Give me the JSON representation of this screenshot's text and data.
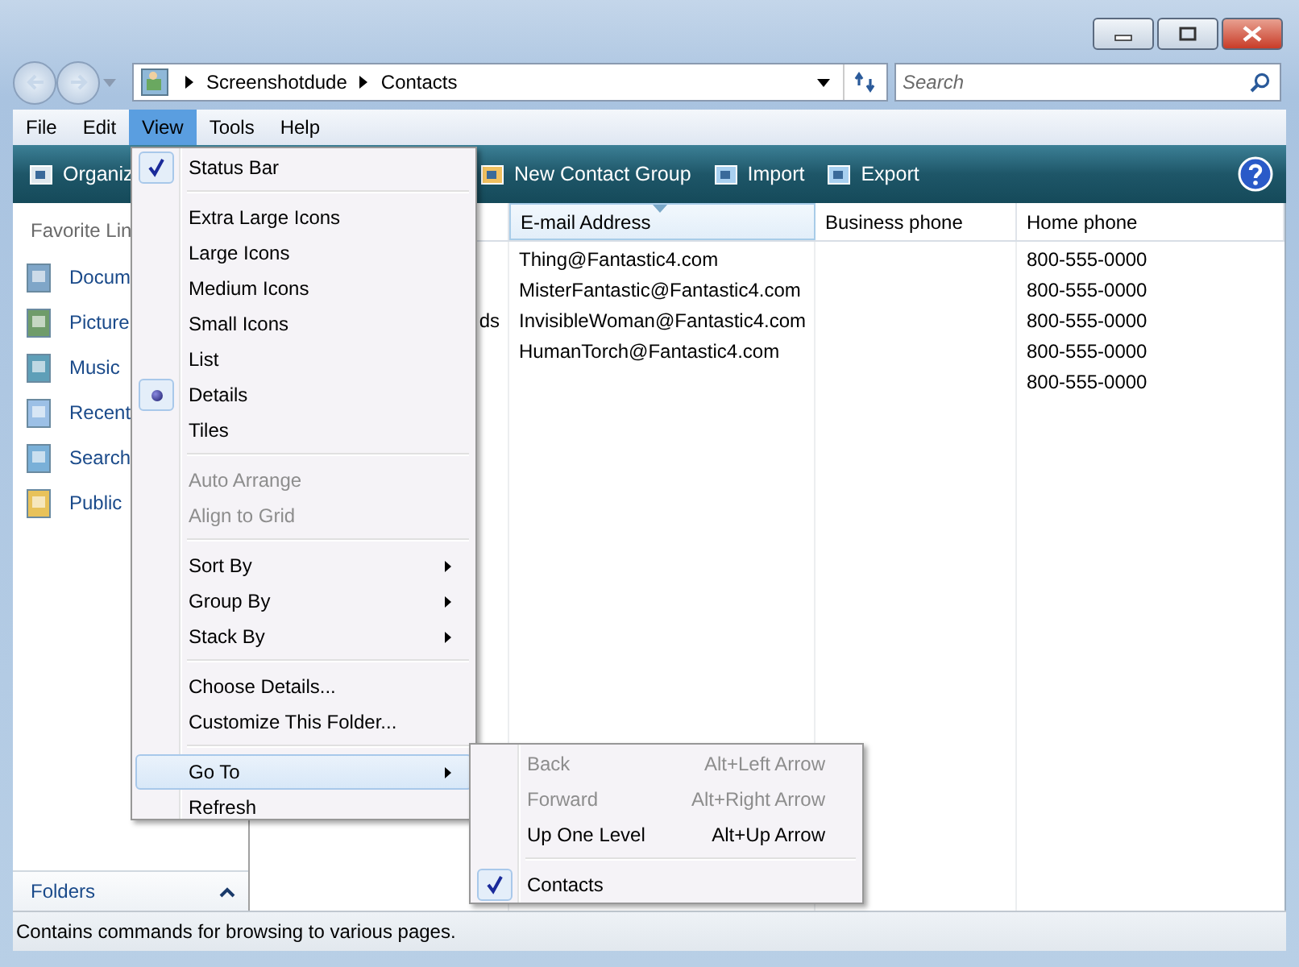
{
  "address": {
    "crumbs": [
      "Screenshotdude",
      "Contacts"
    ]
  },
  "search": {
    "placeholder": "Search"
  },
  "menubar": {
    "items": [
      {
        "label": "File",
        "selected": false
      },
      {
        "label": "Edit",
        "selected": false
      },
      {
        "label": "View",
        "selected": true
      },
      {
        "label": "Tools",
        "selected": false
      },
      {
        "label": "Help",
        "selected": false
      }
    ]
  },
  "toolbar": {
    "items": [
      {
        "label": "Organiz",
        "kind": "organize"
      },
      {
        "label": "New Contact Group",
        "kind": "group"
      },
      {
        "label": "Import",
        "kind": "import"
      },
      {
        "label": "Export",
        "kind": "export"
      }
    ]
  },
  "nav": {
    "heading": "Favorite Lin",
    "items": [
      {
        "label": "Docum",
        "kind": "documents"
      },
      {
        "label": "Picture",
        "kind": "pictures"
      },
      {
        "label": "Music",
        "kind": "music"
      },
      {
        "label": "Recent",
        "kind": "recent"
      },
      {
        "label": "Search",
        "kind": "search"
      },
      {
        "label": "Public",
        "kind": "public"
      }
    ]
  },
  "folders_bar": {
    "label": "Folders"
  },
  "table": {
    "columns": [
      {
        "sorted": false
      },
      {
        "label": "E-mail Address",
        "sorted": true
      },
      {
        "label": "Business phone",
        "sorted": false
      },
      {
        "label": "Home phone",
        "sorted": false
      }
    ],
    "rows": [
      [
        "",
        "Thing@Fantastic4.com",
        "",
        "800-555-0000"
      ],
      [
        "",
        "MisterFantastic@Fantastic4.com",
        "",
        "800-555-0000"
      ],
      [
        "ds",
        "InvisibleWoman@Fantastic4.com",
        "",
        "800-555-0000"
      ],
      [
        "",
        "HumanTorch@Fantastic4.com",
        "",
        "800-555-0000"
      ],
      [
        "",
        "",
        "",
        "800-555-0000"
      ]
    ]
  },
  "view_menu": {
    "sections": [
      {
        "items": [
          {
            "label": "Status Bar",
            "kind": "check",
            "checked": true,
            "disabled": false,
            "selected": false
          }
        ]
      },
      {
        "items": [
          {
            "label": "Extra Large Icons",
            "kind": "radio",
            "checked": false,
            "disabled": false,
            "selected": false
          },
          {
            "label": "Large Icons",
            "kind": "radio",
            "checked": false,
            "disabled": false,
            "selected": false
          },
          {
            "label": "Medium Icons",
            "kind": "radio",
            "checked": false,
            "disabled": false,
            "selected": false
          },
          {
            "label": "Small Icons",
            "kind": "radio",
            "checked": false,
            "disabled": false,
            "selected": false
          },
          {
            "label": "List",
            "kind": "radio",
            "checked": false,
            "disabled": false,
            "selected": false
          },
          {
            "label": "Details",
            "kind": "radio",
            "checked": true,
            "disabled": false,
            "selected": false
          },
          {
            "label": "Tiles",
            "kind": "radio",
            "checked": false,
            "disabled": false,
            "selected": false
          }
        ]
      },
      {
        "items": [
          {
            "label": "Auto Arrange",
            "kind": "check",
            "checked": false,
            "disabled": true,
            "selected": false
          },
          {
            "label": "Align to Grid",
            "kind": "check",
            "checked": false,
            "disabled": true,
            "selected": false
          }
        ]
      },
      {
        "items": [
          {
            "label": "Sort By",
            "kind": "submenu",
            "disabled": false,
            "selected": false
          },
          {
            "label": "Group By",
            "kind": "submenu",
            "disabled": false,
            "selected": false
          },
          {
            "label": "Stack By",
            "kind": "submenu",
            "disabled": false,
            "selected": false
          }
        ]
      },
      {
        "items": [
          {
            "label": "Choose Details...",
            "kind": "command",
            "disabled": false,
            "selected": false
          },
          {
            "label": "Customize This Folder...",
            "kind": "command",
            "disabled": false,
            "selected": false
          }
        ]
      },
      {
        "items": [
          {
            "label": "Go To",
            "kind": "submenu",
            "disabled": false,
            "selected": true
          },
          {
            "label": "Refresh",
            "kind": "command",
            "disabled": false,
            "selected": false
          }
        ]
      }
    ]
  },
  "goto_menu": {
    "sections": [
      {
        "items": [
          {
            "label": "Back",
            "shortcut": "Alt+Left Arrow",
            "disabled": true,
            "checked": false
          },
          {
            "label": "Forward",
            "shortcut": "Alt+Right Arrow",
            "disabled": true,
            "checked": false
          },
          {
            "label": "Up One Level",
            "shortcut": "Alt+Up Arrow",
            "disabled": false,
            "checked": false
          }
        ]
      },
      {
        "items": [
          {
            "label": "Contacts",
            "disabled": false,
            "checked": true
          }
        ]
      }
    ]
  },
  "status_bar": {
    "text": "Contains commands for browsing to various pages."
  }
}
